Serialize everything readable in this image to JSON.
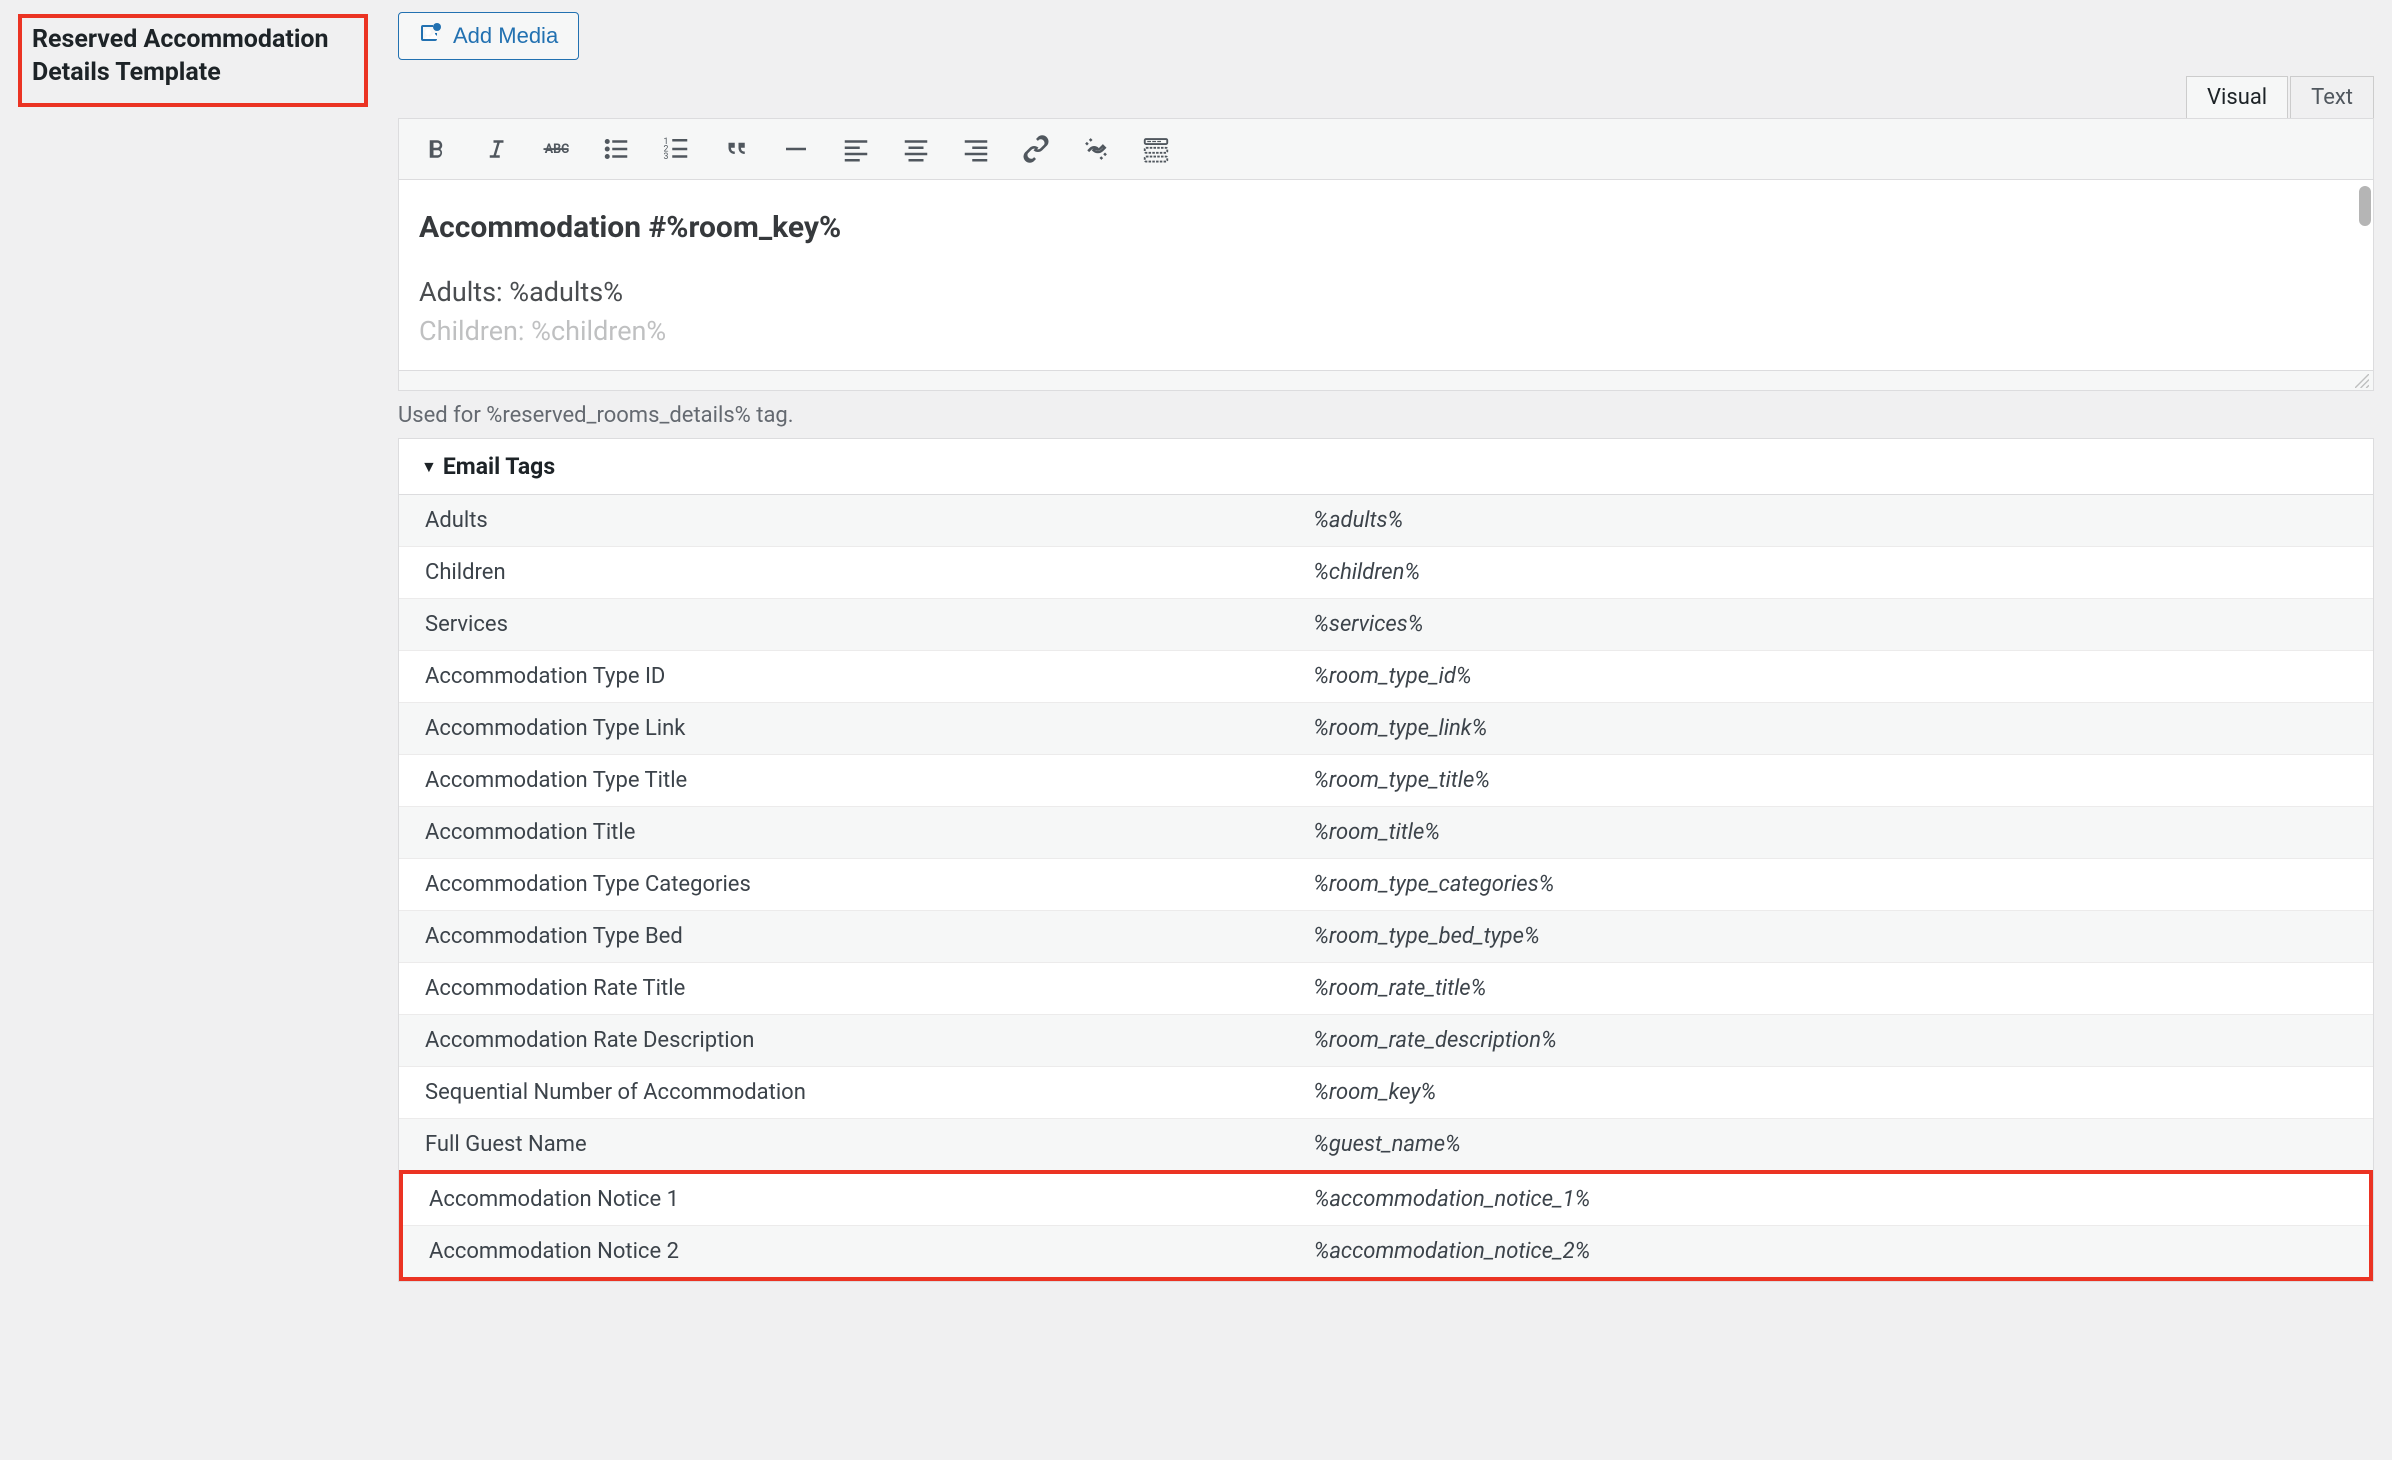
{
  "section_title": "Reserved Accommodation Details Template",
  "add_media_label": "Add Media",
  "tabs": {
    "visual": "Visual",
    "text": "Text"
  },
  "editor": {
    "heading": "Accommodation #%room_key%",
    "line1": "Adults: %adults%",
    "line2": "Children: %children%"
  },
  "helper_text": "Used for %reserved_rooms_details% tag.",
  "email_tags_header": "Email Tags",
  "email_tags": [
    {
      "name": "Adults",
      "tag": "%adults%"
    },
    {
      "name": "Children",
      "tag": "%children%"
    },
    {
      "name": "Services",
      "tag": "%services%"
    },
    {
      "name": "Accommodation Type ID",
      "tag": "%room_type_id%"
    },
    {
      "name": "Accommodation Type Link",
      "tag": "%room_type_link%"
    },
    {
      "name": "Accommodation Type Title",
      "tag": "%room_type_title%"
    },
    {
      "name": "Accommodation Title",
      "tag": "%room_title%"
    },
    {
      "name": "Accommodation Type Categories",
      "tag": "%room_type_categories%"
    },
    {
      "name": "Accommodation Type Bed",
      "tag": "%room_type_bed_type%"
    },
    {
      "name": "Accommodation Rate Title",
      "tag": "%room_rate_title%"
    },
    {
      "name": "Accommodation Rate Description",
      "tag": "%room_rate_description%"
    },
    {
      "name": "Sequential Number of Accommodation",
      "tag": "%room_key%"
    },
    {
      "name": "Full Guest Name",
      "tag": "%guest_name%"
    }
  ],
  "highlighted_tags": [
    {
      "name": "Accommodation Notice 1",
      "tag": "%accommodation_notice_1%"
    },
    {
      "name": "Accommodation Notice 2",
      "tag": "%accommodation_notice_2%"
    }
  ]
}
